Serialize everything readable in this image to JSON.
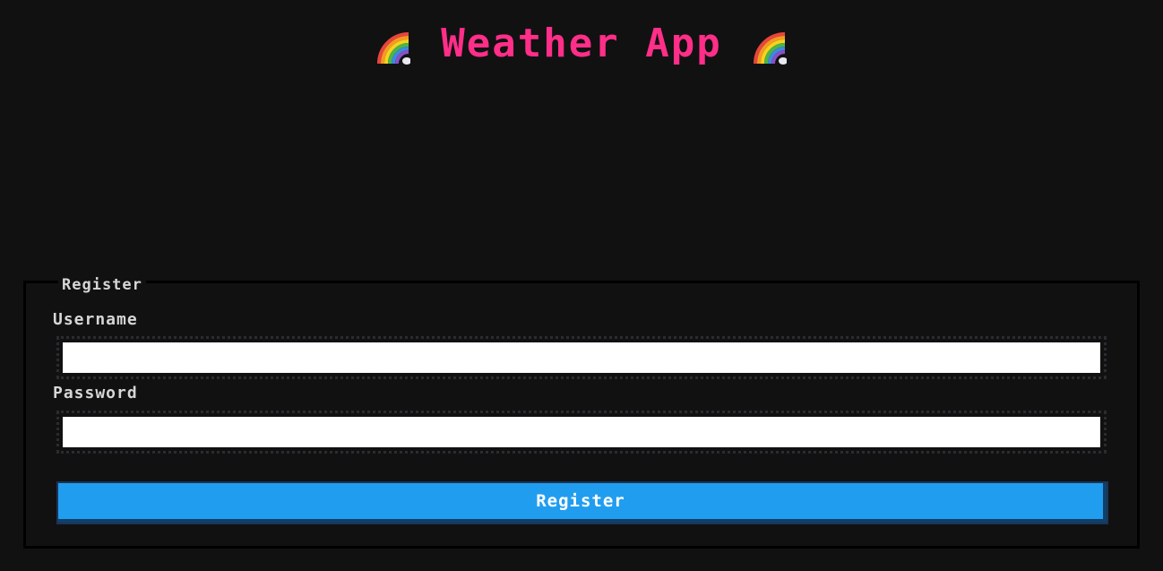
{
  "header": {
    "title": "Weather App",
    "left_icon": "rainbow-icon",
    "right_icon": "rainbow-icon",
    "title_color": "#ff2e88"
  },
  "form": {
    "legend": "Register",
    "username_label": "Username",
    "username_value": "",
    "password_label": "Password",
    "password_value": "",
    "submit_label": "Register",
    "button_color": "#219df0"
  }
}
